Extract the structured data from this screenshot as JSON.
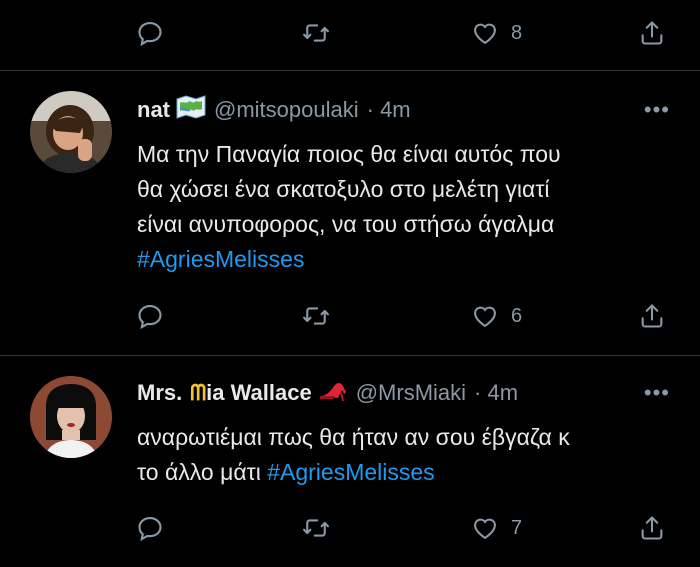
{
  "top_actions": {
    "like_count": "8"
  },
  "tweets": [
    {
      "name": "nat",
      "name_suffix": "",
      "handle": "@mitsopoulaki",
      "time": "· 4m",
      "text_lines": [
        "Μα την Παναγία ποιος θα είναι αυτός που",
        "θα χώσει ένα σκατοξυλο στο μελέτη γιατί",
        "είναι ανυποφορος, να του στήσω άγαλμα"
      ],
      "hashtag": "#AgriesMelisses",
      "like_count": "6"
    },
    {
      "name": "Mrs.",
      "name_m_glyph": "ᗰ",
      "name_suffix": "ia Wallace",
      "handle": "@MrsMiaki",
      "time": "· 4m",
      "text_lines": [
        "αναρωτιέμαι πως θα ήταν αν σου έβγαζα κ"
      ],
      "line2_text": "το άλλο μάτι",
      "hashtag": "#AgriesMelisses",
      "like_count": "7"
    }
  ],
  "more_label": "•••",
  "colors": {
    "background": "#000000",
    "text": "#e7e9ea",
    "muted": "#8b98a5",
    "link": "#1d9bf0",
    "divider": "#2f3336"
  },
  "icons": [
    "reply-icon",
    "retweet-icon",
    "like-icon",
    "share-icon",
    "map-emoji-icon",
    "high-heel-emoji-icon",
    "more-icon"
  ]
}
